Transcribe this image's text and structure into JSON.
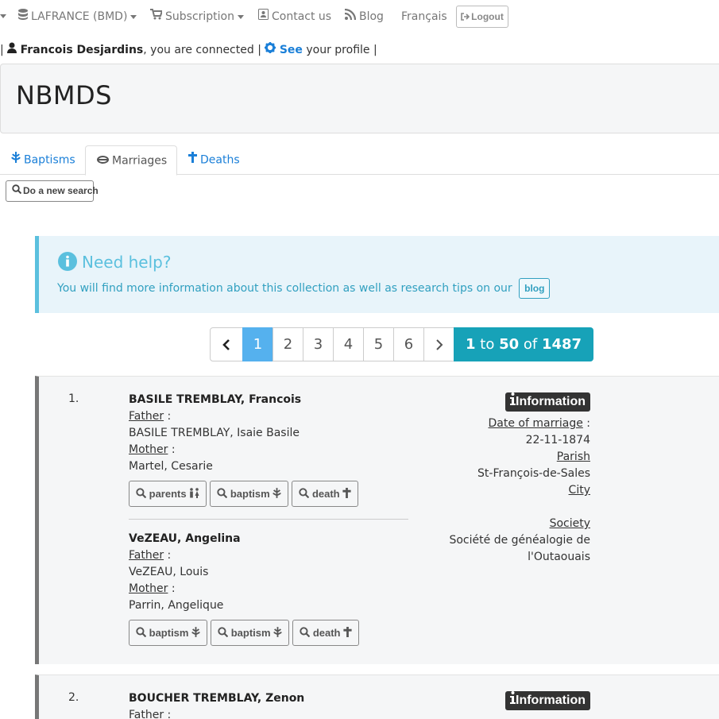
{
  "nav": {
    "db_label": "LAFRANCE (BMD)",
    "subscription": "Subscription",
    "contact": "Contact us",
    "blog": "Blog",
    "language": "Français",
    "logout": "Logout"
  },
  "user": {
    "name": "Francois Desjardins",
    "connected_text": ", you are connected",
    "see": "See",
    "profile_text": "your profile"
  },
  "page_title": "NBMDS",
  "tabs": [
    "Baptisms",
    "Marriages",
    "Deaths"
  ],
  "new_search": "Do a new search",
  "help": {
    "title": "Need help?",
    "text": "You will find more information about this collection as well as research tips on our",
    "blog_button": "blog"
  },
  "pagination": {
    "pages": [
      "1",
      "2",
      "3",
      "4",
      "5",
      "6"
    ],
    "active": "1",
    "range_from": "1",
    "range_to_word": "to",
    "range_to": "50",
    "of_word": "of",
    "total": "1487"
  },
  "labels": {
    "father": "Father",
    "mother": "Mother",
    "colon": " :",
    "information": "Information",
    "date_of_marriage": "Date of marriage",
    "parish": "Parish",
    "city": "City",
    "society": "Society",
    "btn_parents": "parents",
    "btn_baptism": "baptism",
    "btn_death": "death"
  },
  "records": [
    {
      "number": "1.",
      "groom": {
        "name": "BASILE TREMBLAY, Francois",
        "father": "BASILE TREMBLAY, Isaie Basile",
        "mother": "Martel, Cesarie"
      },
      "bride": {
        "name": "VeZEAU, Angelina",
        "father": "VeZEAU, Louis",
        "mother": "Parrin, Angelique"
      },
      "date": "22-11-1874",
      "parish": "St-François-de-Sales",
      "society_line1": "Société de généalogie de",
      "society_line2": "l'Outaouais"
    },
    {
      "number": "2.",
      "groom": {
        "name": "BOUCHER TREMBLAY, Zenon",
        "father_label_only": true
      }
    }
  ],
  "colors": {
    "link_blue": "#1a7fd8",
    "info_cyan": "#5bc0de",
    "active_page": "#55b1ee",
    "count_teal": "#17a2b8",
    "record_border": "#777777"
  }
}
